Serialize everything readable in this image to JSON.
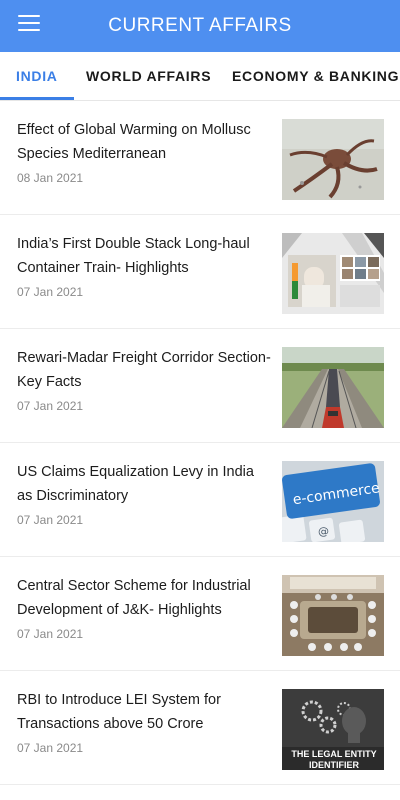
{
  "app": {
    "title": "CURRENT AFFAIRS"
  },
  "tabs": [
    {
      "label": "INDIA",
      "active": true
    },
    {
      "label": "WORLD AFFAIRS",
      "active": false
    },
    {
      "label": "ECONOMY & BANKING",
      "active": false
    }
  ],
  "articles": [
    {
      "title": "Effect of Global Warming on Mollusc Species Mediterranean",
      "date": "08 Jan 2021",
      "thumbnail": "octopus-on-beach-image"
    },
    {
      "title": "India’s First Double Stack Long-haul Container Train- Highlights",
      "date": "07 Jan 2021",
      "thumbnail": "video-conference-image"
    },
    {
      "title": "Rewari-Madar Freight Corridor Section- Key Facts",
      "date": "07 Jan 2021",
      "thumbnail": "freight-train-image"
    },
    {
      "title": "US Claims Equalization Levy in India as Discriminatory",
      "date": "07 Jan 2021",
      "thumbnail": "e-commerce-keyboard-image"
    },
    {
      "title": "Central Sector Scheme for Industrial Development of J&K- Highlights",
      "date": "07 Jan 2021",
      "thumbnail": "cabinet-meeting-image"
    },
    {
      "title": "RBI to Introduce LEI System for Transactions above 50 Crore",
      "date": "07 Jan 2021",
      "thumbnail": "legal-entity-identifier-image",
      "thumbnail_text": "THE LEGAL ENTITY IDENTIFIER"
    }
  ],
  "colors": {
    "appbar": "#4e8ff0",
    "accent": "#3b7fe6",
    "date_text": "#8a8a8a"
  }
}
